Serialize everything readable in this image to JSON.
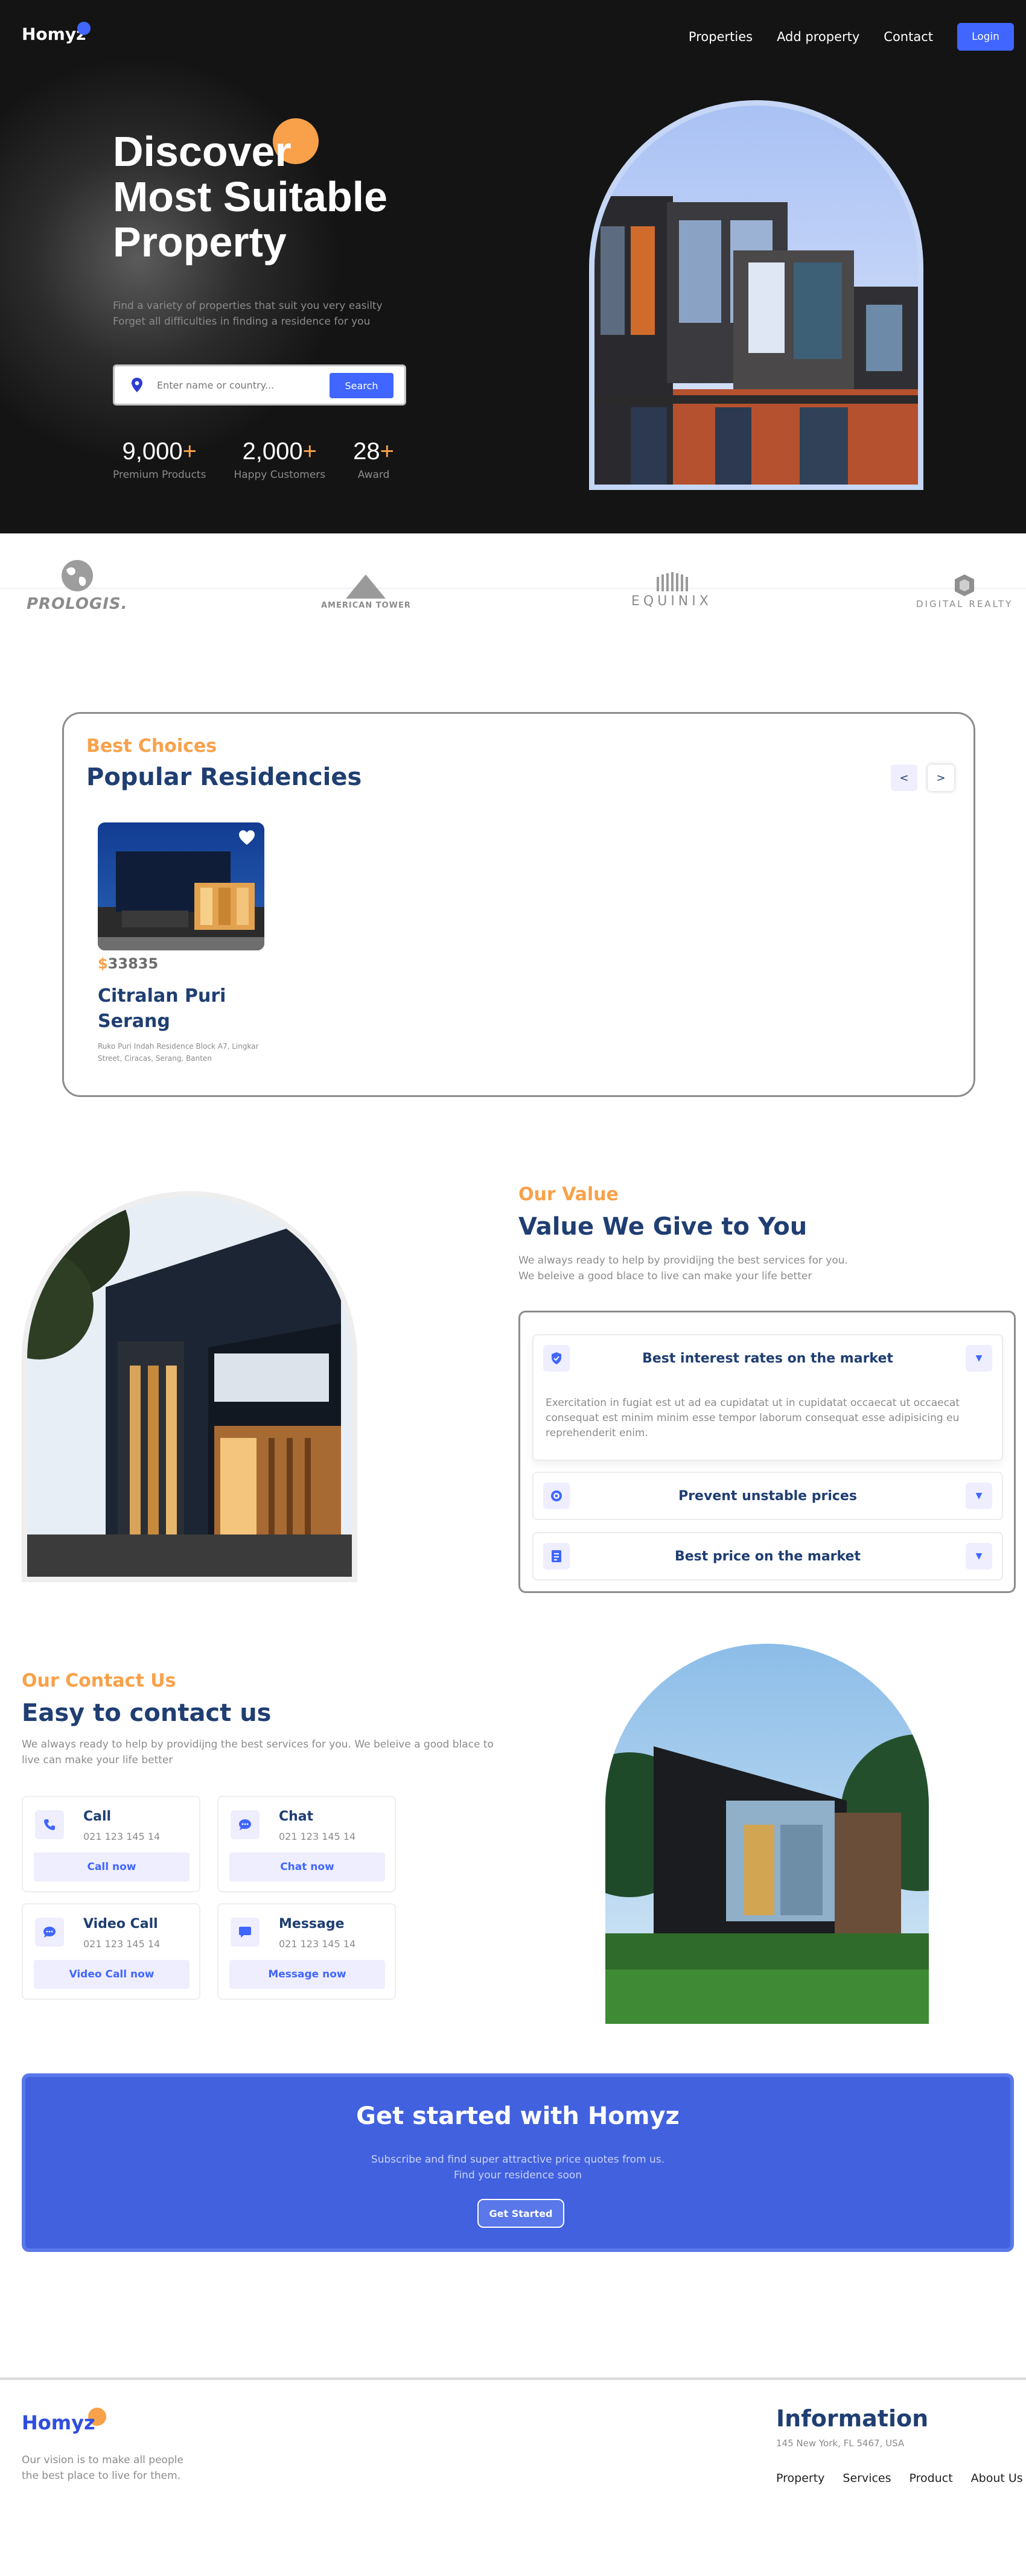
{
  "header": {
    "logo": "Homyz",
    "nav": [
      "Properties",
      "Add property",
      "Contact"
    ],
    "login_label": "Login"
  },
  "hero": {
    "title_lines": [
      "Discover",
      "Most Suitable",
      "Property"
    ],
    "desc_lines": [
      "Find a variety of properties that suit you very easilty",
      "Forget all difficulties in finding a residence for you"
    ],
    "search_placeholder": "Enter name or country...",
    "search_label": "Search",
    "stats": [
      {
        "value": "9,000",
        "suffix": "+",
        "label": "Premium Products"
      },
      {
        "value": "2,000",
        "suffix": "+",
        "label": "Happy Customers"
      },
      {
        "value": "28",
        "suffix": "+",
        "label": "Award"
      }
    ]
  },
  "companies": [
    "PROLOGIS.",
    "AMERICAN TOWER",
    "EQUINIX",
    "DIGITAL REALTY"
  ],
  "residencies": {
    "subtitle": "Best Choices",
    "title": "Popular Residencies",
    "prev_label": "<",
    "next_label": ">",
    "items": [
      {
        "currency": "$",
        "price": "33835",
        "name": "Citralan Puri Serang",
        "address": "Ruko Puri Indah Residence Block A7, Lingkar Street, Ciracas, Serang, Banten"
      }
    ]
  },
  "value": {
    "subtitle": "Our Value",
    "title": "Value We Give to You",
    "desc_lines": [
      "We always ready to help by providijng the best services for you.",
      "We beleive a good blace to live can make your life better"
    ],
    "items": [
      {
        "icon": "shield-check-icon",
        "title": "Best interest rates on the market",
        "body": "Exercitation in fugiat est ut ad ea cupidatat ut in cupidatat occaecat ut occaecat consequat est minim minim esse tempor laborum consequat esse adipisicing eu reprehenderit enim.",
        "expanded": true
      },
      {
        "icon": "target-icon",
        "title": "Prevent unstable prices",
        "expanded": false
      },
      {
        "icon": "document-icon",
        "title": "Best price on the market",
        "expanded": false
      }
    ]
  },
  "contact": {
    "subtitle": "Our Contact Us",
    "title": "Easy to contact us",
    "desc": "We always ready to help by providijng the best services for you. We beleive a good blace to live can make your life better",
    "cards": [
      {
        "icon": "phone-icon",
        "title": "Call",
        "phone": "021 123 145 14",
        "button": "Call now"
      },
      {
        "icon": "chat-icon",
        "title": "Chat",
        "phone": "021 123 145 14",
        "button": "Chat now"
      },
      {
        "icon": "video-chat-icon",
        "title": "Video Call",
        "phone": "021 123 145 14",
        "button": "Video Call now"
      },
      {
        "icon": "message-icon",
        "title": "Message",
        "phone": "021 123 145 14",
        "button": "Message now"
      }
    ]
  },
  "cta": {
    "title": "Get started with Homyz",
    "desc_lines": [
      "Subscribe and find super attractive price quotes from us.",
      "Find your residence soon"
    ],
    "button": "Get Started"
  },
  "footer": {
    "logo": "Homyz",
    "vision": "Our vision is to make all people the best place to live for them.",
    "info_title": "Information",
    "address": "145 New York, FL 5467, USA",
    "links": [
      "Property",
      "Services",
      "Product",
      "About Us"
    ]
  },
  "colors": {
    "accent": "#4066ff",
    "orange": "#f8a14a",
    "navy": "#1f3e72",
    "hero_bg": "#141414",
    "cta_bg": "#4161df"
  }
}
